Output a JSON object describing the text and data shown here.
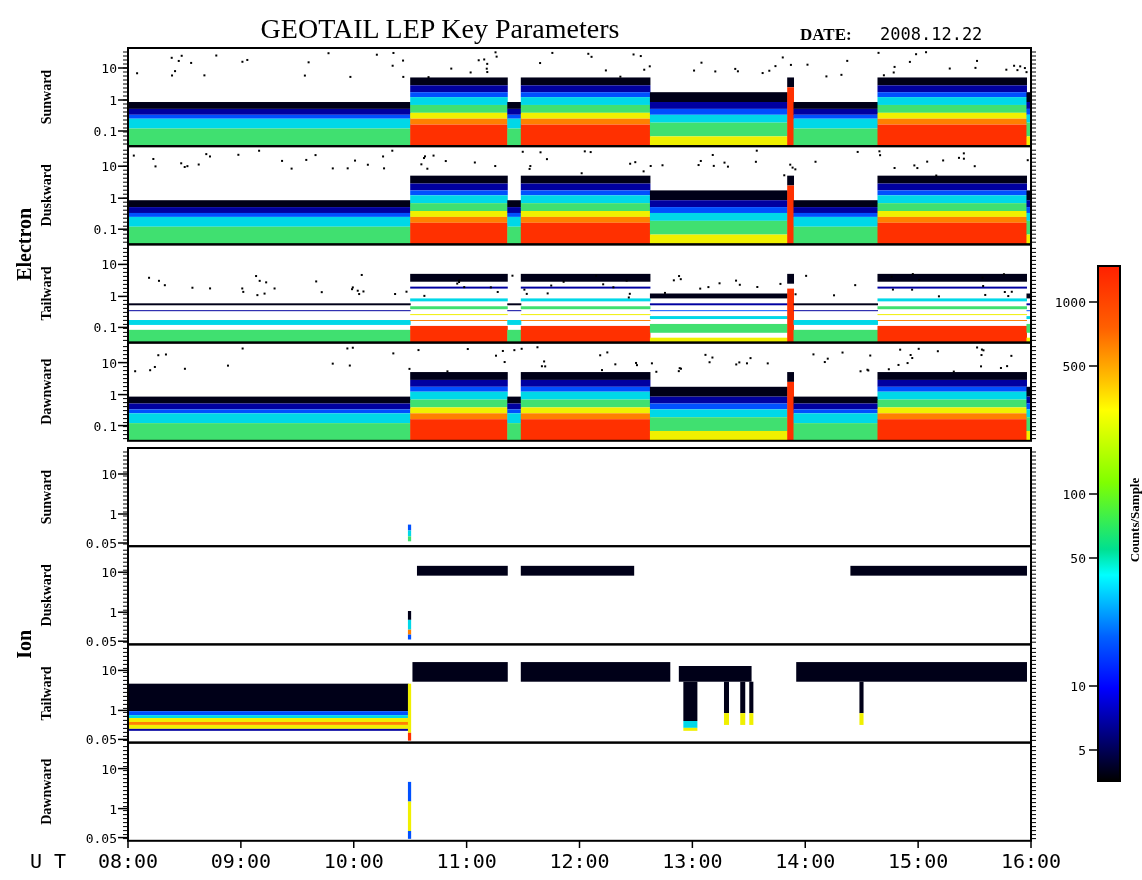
{
  "title": "GEOTAIL LEP Key Parameters",
  "date_label": "DATE:",
  "date": "2008.12.22",
  "groups": [
    {
      "label": "Electron",
      "kind": "electron",
      "panels": [
        {
          "label": "Sunward",
          "yticks": [
            "10",
            "1",
            "0.1"
          ]
        },
        {
          "label": "Duskward",
          "yticks": [
            "10",
            "1",
            "0.1"
          ]
        },
        {
          "label": "Tailward",
          "yticks": [
            "10",
            "1",
            "0.1"
          ]
        },
        {
          "label": "Dawnward",
          "yticks": [
            "10",
            "1",
            "0.1"
          ]
        }
      ]
    },
    {
      "label": "Ion",
      "kind": "ion",
      "panels": [
        {
          "label": "Sunward",
          "yticks": [
            "10",
            "1",
            "0.05"
          ]
        },
        {
          "label": "Duskward",
          "yticks": [
            "10",
            "1",
            "0.05"
          ]
        },
        {
          "label": "Tailward",
          "yticks": [
            "10",
            "1",
            "0.05"
          ]
        },
        {
          "label": "Dawnward",
          "yticks": [
            "10",
            "1",
            "0.05"
          ]
        }
      ]
    }
  ],
  "time_axis": {
    "label": "U T",
    "ticks": [
      "08:00",
      "09:00",
      "10:00",
      "11:00",
      "12:00",
      "13:00",
      "14:00",
      "15:00",
      "16:00"
    ]
  },
  "colorbar": {
    "title": "Counts/Sample",
    "ticks": [
      "1000",
      "500",
      "100",
      "50",
      "10",
      "5"
    ]
  }
}
